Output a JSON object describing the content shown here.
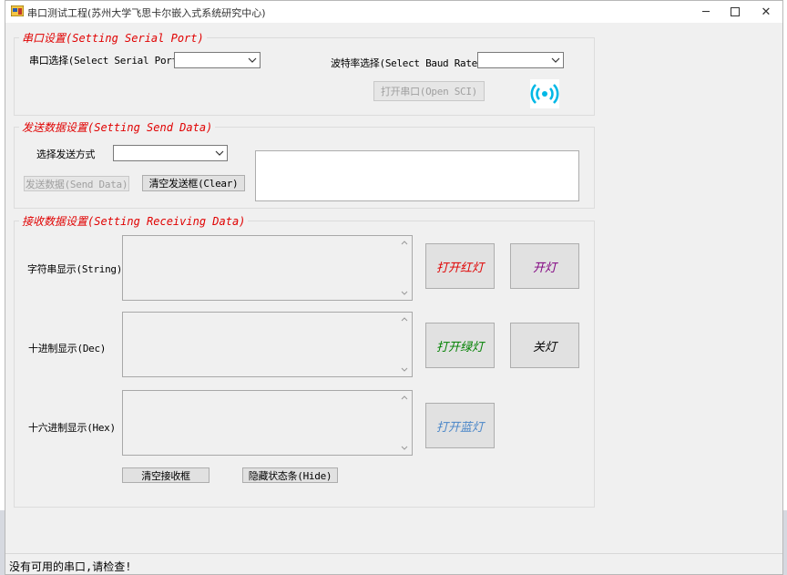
{
  "window": {
    "title": "串口测试工程(苏州大学飞思卡尔嵌入式系统研究中心)"
  },
  "serial_port": {
    "legend": "串口设置(Setting Serial Port)",
    "port_label": "串口选择(Select Serial Port)",
    "port_value": "",
    "baud_label": "波特率选择(Select Baud Rate)",
    "baud_value": "",
    "open_button": "打开串口(Open SCI)"
  },
  "send_data": {
    "legend": "发送数据设置(Setting Send Data)",
    "mode_label": "选择发送方式",
    "mode_value": "",
    "send_button": "发送数据(Send Data)",
    "clear_button": "清空发送框(Clear)",
    "send_text": ""
  },
  "receive_data": {
    "legend": "接收数据设置(Setting Receiving Data)",
    "string_label": "字符串显示(String)",
    "dec_label": "十进制显示(Dec)",
    "hex_label": "十六进制显示(Hex)",
    "string_text": "",
    "dec_text": "",
    "hex_text": "",
    "clear_button": "清空接收框",
    "hide_button": "隐藏状态条(Hide)"
  },
  "lights": {
    "red": {
      "label": "打开红灯",
      "color": "#e00000"
    },
    "green": {
      "label": "打开绿灯",
      "color": "#008000"
    },
    "blue": {
      "label": "打开蓝灯",
      "color": "#4a86c8"
    },
    "on": {
      "label": "开灯",
      "color": "#800080"
    },
    "off": {
      "label": "关灯",
      "color": "#000000"
    }
  },
  "status": {
    "text": "没有可用的串口,请检查!"
  },
  "icons": {
    "signal": "signal-broadcast-icon",
    "app": "app-window-icon"
  }
}
